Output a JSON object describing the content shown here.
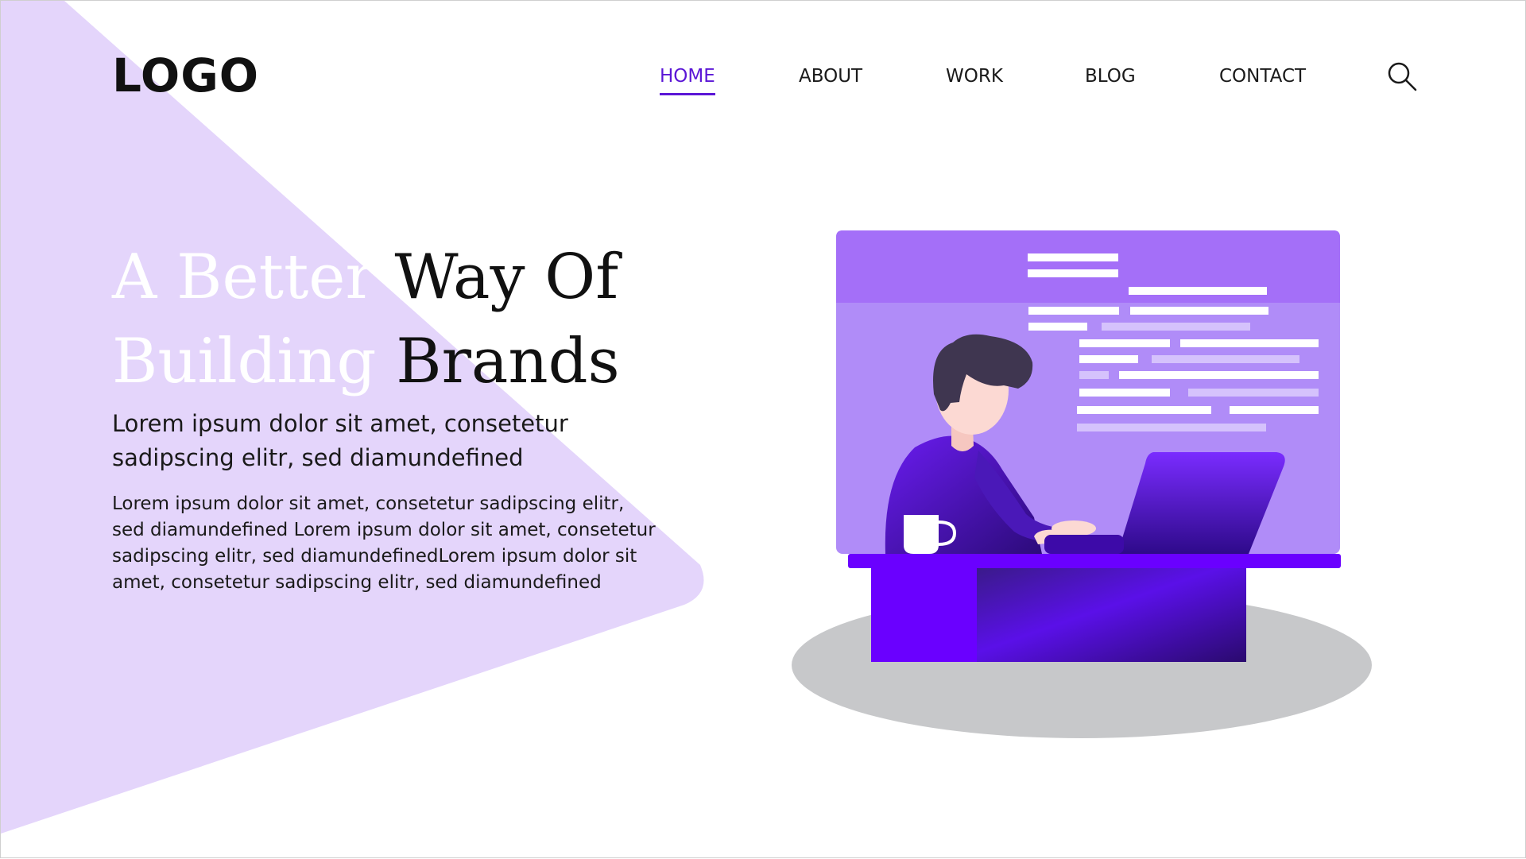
{
  "header": {
    "logo": "LOGO",
    "nav": [
      {
        "label": "HOME",
        "active": true
      },
      {
        "label": "ABOUT",
        "active": false
      },
      {
        "label": "WORK",
        "active": false
      },
      {
        "label": "BLOG",
        "active": false
      },
      {
        "label": "CONTACT",
        "active": false
      }
    ],
    "search_icon": "search-icon"
  },
  "hero": {
    "headline": {
      "line1_light": "A Better",
      "line1_dark": "Way Of",
      "line2_light": "Building",
      "line2_dark": "Brands"
    },
    "subtitle": "Lorem ipsum dolor sit amet, consetetur sadipscing elitr, sed diamundefined",
    "body": "Lorem ipsum dolor sit amet, consetetur sadipscing elitr, sed diamundefined Lorem ipsum dolor sit amet, consetetur sadipscing elitr, sed diamundefinedLorem ipsum dolor sit amet, consetetur sadipscing elitr, sed diamundefined"
  },
  "colors": {
    "accent": "#5b16d6",
    "triangle": "#e4d5fb",
    "screen": "#a779f7",
    "desk": "#6a00ff",
    "shadow": "#c7c8ca"
  }
}
